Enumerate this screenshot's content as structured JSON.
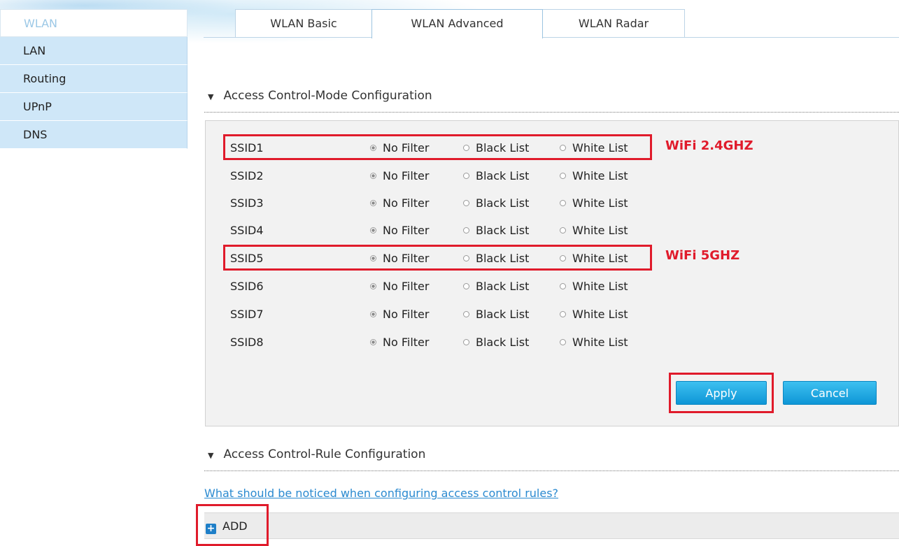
{
  "sidebar": {
    "items": [
      {
        "label": "WLAN",
        "active": true
      },
      {
        "label": "LAN",
        "active": false
      },
      {
        "label": "Routing",
        "active": false
      },
      {
        "label": "UPnP",
        "active": false
      },
      {
        "label": "DNS",
        "active": false
      }
    ]
  },
  "tabs": [
    {
      "label": "WLAN Basic",
      "active": false
    },
    {
      "label": "WLAN Advanced",
      "active": true
    },
    {
      "label": "WLAN Radar",
      "active": false
    }
  ],
  "mode_section": {
    "title": "Access Control-Mode Configuration",
    "options": [
      "No Filter",
      "Black List",
      "White List"
    ],
    "rows": [
      {
        "ssid": "SSID1",
        "selected": "No Filter"
      },
      {
        "ssid": "SSID2",
        "selected": "No Filter"
      },
      {
        "ssid": "SSID3",
        "selected": "No Filter"
      },
      {
        "ssid": "SSID4",
        "selected": "No Filter"
      },
      {
        "ssid": "SSID5",
        "selected": "No Filter"
      },
      {
        "ssid": "SSID6",
        "selected": "No Filter"
      },
      {
        "ssid": "SSID7",
        "selected": "No Filter"
      },
      {
        "ssid": "SSID8",
        "selected": "No Filter"
      }
    ],
    "annotations": {
      "ssid1": "WiFi 2.4GHZ",
      "ssid5": "WiFi 5GHZ"
    },
    "apply_label": "Apply",
    "cancel_label": "Cancel"
  },
  "rule_section": {
    "title": "Access Control-Rule Configuration",
    "help_link": "What should be noticed when configuring access control rules?",
    "add_label": "ADD"
  },
  "colors": {
    "highlight": "#e01b2b",
    "button": "#1aa6e4",
    "sidebar": "#cfe7f8",
    "link": "#2b8ad0"
  }
}
